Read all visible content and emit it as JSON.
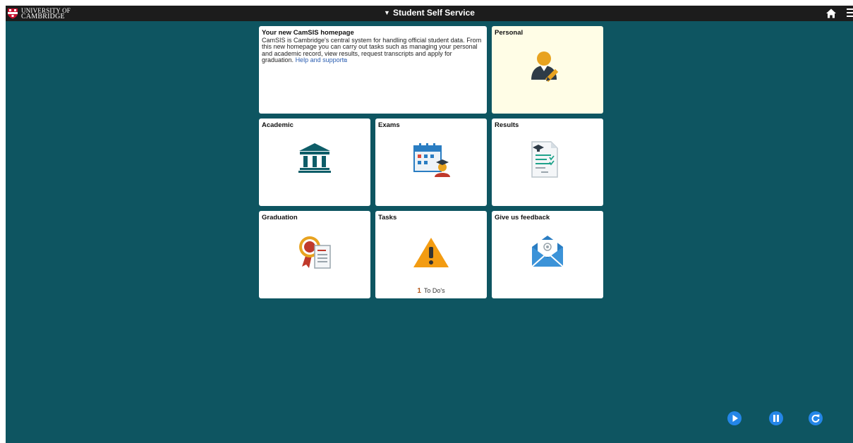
{
  "header": {
    "logo_line1": "UNIVERSITY OF",
    "logo_line2": "CAMBRIDGE",
    "title": "Student Self Service",
    "home_icon": "home-icon",
    "menu_icon": "hamburger-menu-icon"
  },
  "intro": {
    "title": "Your new CamSIS homepage",
    "body": "CamSIS is Cambridge's central system for handling official student data. From this new homepage you can carry out tasks such as managing your personal and academic record, view results, request transcripts and apply for graduation.",
    "link": "Help and support"
  },
  "tiles": {
    "personal": {
      "title": "Personal",
      "icon": "person-edit-icon"
    },
    "academic": {
      "title": "Academic",
      "icon": "institution-icon"
    },
    "exams": {
      "title": "Exams",
      "icon": "calendar-graduate-icon"
    },
    "results": {
      "title": "Results",
      "icon": "results-document-icon"
    },
    "graduation": {
      "title": "Graduation",
      "icon": "award-certificate-icon"
    },
    "tasks": {
      "title": "Tasks",
      "icon": "warning-icon",
      "count": "1",
      "count_label": "To Do's"
    },
    "feedback": {
      "title": "Give us feedback",
      "icon": "envelope-icon"
    }
  },
  "colors": {
    "background": "#0e5561",
    "topbar": "#1c1c1c",
    "personal_tile": "#fffde6",
    "media_button": "#2486e8"
  },
  "media_controls": [
    "play-icon",
    "pause-icon",
    "replay-icon"
  ]
}
